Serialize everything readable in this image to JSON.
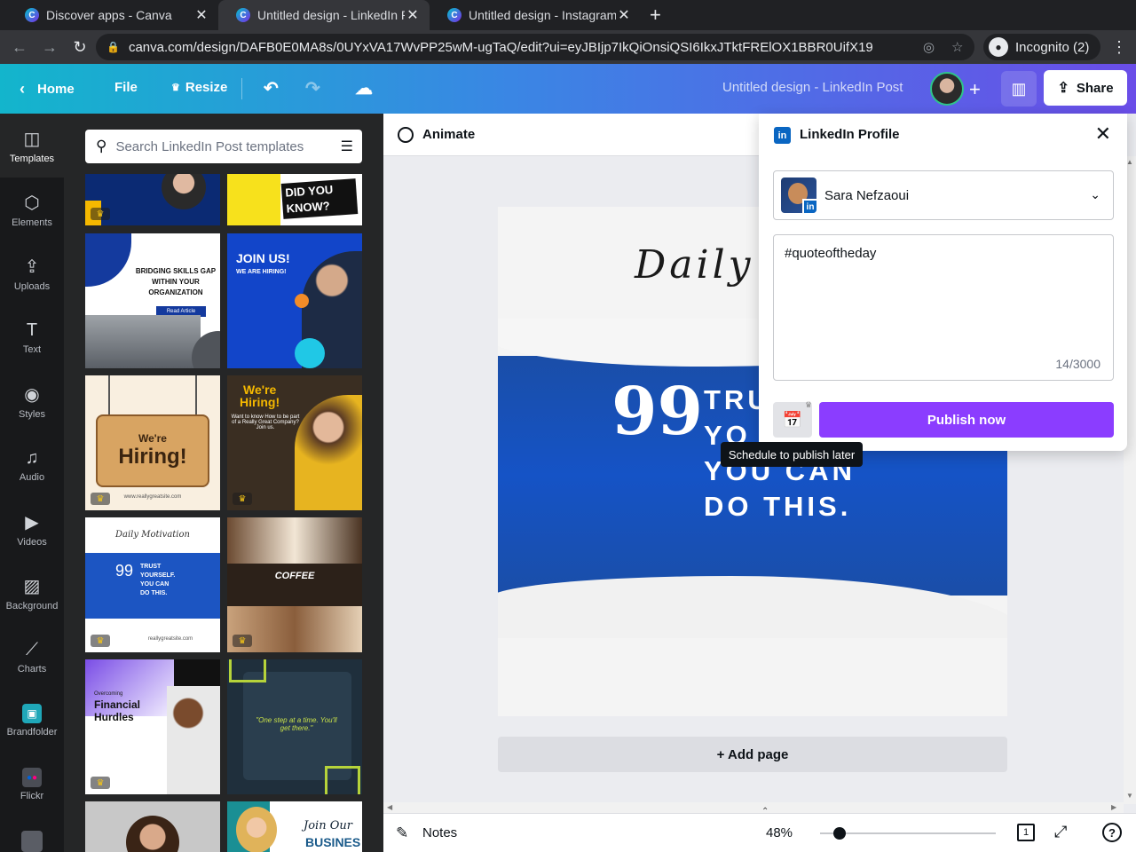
{
  "browser": {
    "tabs": [
      {
        "title": "Discover apps - Canva",
        "active": false
      },
      {
        "title": "Untitled design - LinkedIn P",
        "active": true
      },
      {
        "title": "Untitled design - Instagram",
        "active": false
      }
    ],
    "url": "canva.com/design/DAFB0E0MA8s/0UYxVA17WvPP25wM-ugTaQ/edit?ui=eyJBIjp7IkQiOnsiQSI6IkxJTktFRElOX1BBR0UifX19",
    "incognito_label": "Incognito (2)"
  },
  "header": {
    "home": "Home",
    "file": "File",
    "resize": "Resize",
    "doc_title": "Untitled design - LinkedIn Post",
    "share": "Share"
  },
  "rail": {
    "items": [
      {
        "label": "Templates",
        "icon": "templates-icon"
      },
      {
        "label": "Elements",
        "icon": "elements-icon"
      },
      {
        "label": "Uploads",
        "icon": "upload-icon"
      },
      {
        "label": "Text",
        "icon": "text-icon"
      },
      {
        "label": "Styles",
        "icon": "palette-icon"
      },
      {
        "label": "Audio",
        "icon": "music-icon"
      },
      {
        "label": "Videos",
        "icon": "video-icon"
      },
      {
        "label": "Background",
        "icon": "background-icon"
      },
      {
        "label": "Charts",
        "icon": "chart-icon"
      },
      {
        "label": "Brandfolder",
        "icon": "brandfolder-icon"
      },
      {
        "label": "Flickr",
        "icon": "flickr-icon"
      }
    ]
  },
  "panel": {
    "search_placeholder": "Search LinkedIn Post templates",
    "templates": {
      "t1": "DID YOU KNOW?",
      "t2_l1": "BRIDGING SKILLS GAP",
      "t2_l2": "WITHIN YOUR",
      "t2_l3": "ORGANIZATION",
      "t2_btn": "Read Article",
      "t3_title": "JOIN US!",
      "t3_sub": "WE ARE HIRING!",
      "t4_l1": "We're",
      "t4_l2": "Hiring!",
      "t4_url": "www.reallygreatsite.com",
      "t5_l1": "We're",
      "t5_l2": "Hiring!",
      "t5_sub": "Want to know How to be part of a Really Great Company? Join us.",
      "t6_head": "Daily Motivation",
      "t6_l1": "TRUST",
      "t6_l2": "YOURSELF.",
      "t6_l3": "YOU CAN",
      "t6_l4": "DO THIS.",
      "t6_url": "reallygreatsite.com",
      "t7_title": "COFFEE",
      "t8_l1": "Overcoming",
      "t8_l2": "Financial",
      "t8_l3": "Hurdles",
      "t9_quote": "\"One step at a time. You'll get there.\"",
      "t11_l1": "Join Our",
      "t11_l2": "BUSINES"
    }
  },
  "editor": {
    "animate": "Animate",
    "design_heading": "Daily M",
    "design_l1": "TRU",
    "design_l2": "YO",
    "design_l3": "YOU CAN",
    "design_l4": "DO THIS.",
    "add_page": "+ Add page",
    "notes": "Notes",
    "zoom": "48%",
    "zoom_fraction": 0.48,
    "page_number": "1"
  },
  "publish": {
    "title": "LinkedIn Profile",
    "account": "Sara Nefzaoui",
    "message": "#quoteoftheday",
    "counter": "14/3000",
    "publish_now": "Publish now",
    "tooltip": "Schedule to publish later"
  },
  "colors": {
    "accent": "#8b3dff",
    "linkedin": "#0a66c2",
    "design_blue": "#1c55c2"
  }
}
